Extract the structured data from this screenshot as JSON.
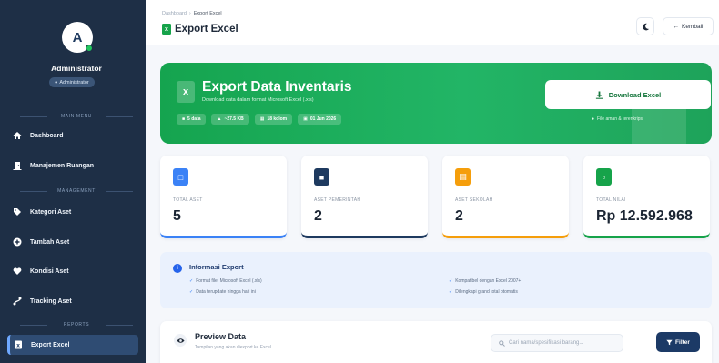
{
  "user": {
    "initial": "A",
    "name": "Administrator",
    "role": "Administrator"
  },
  "sidebar": {
    "sections": [
      "MAIN MENU",
      "MANAGEMENT",
      "REPORTS"
    ],
    "items": [
      {
        "label": "Dashboard",
        "icon": "home-icon"
      },
      {
        "label": "Manajemen Ruangan",
        "icon": "door-icon"
      },
      {
        "label": "Kategori Aset",
        "icon": "tag-icon"
      },
      {
        "label": "Tambah Aset",
        "icon": "plus-circle-icon"
      },
      {
        "label": "Kondisi Aset",
        "icon": "heart-icon"
      },
      {
        "label": "Tracking Aset",
        "icon": "route-icon"
      },
      {
        "label": "Export Excel",
        "icon": "excel-icon",
        "active": true
      }
    ]
  },
  "header": {
    "breadcrumb": [
      "Dashboard",
      "Export Excel"
    ],
    "title": "Export Excel",
    "back_label": "Kembali",
    "theme_icon": "moon-icon"
  },
  "hero": {
    "title": "Export Data Inventaris",
    "subtitle": "Download data dalam format Microsoft Excel (.xls)",
    "chips": [
      "5 data",
      "~27.5 KB",
      "18 kolom",
      "01 Jun 2026"
    ],
    "download_label": "Download Excel",
    "note": "File aman & terenkripsi",
    "accent": "#16a34a"
  },
  "stats": [
    {
      "label": "TOTAL ASET",
      "value": "5",
      "color": "#3b82f6",
      "icon": "box-icon"
    },
    {
      "label": "ASET PEMERINTAH",
      "value": "2",
      "color": "#1e3a5f",
      "icon": "building-icon"
    },
    {
      "label": "ASET SEKOLAH",
      "value": "2",
      "color": "#f59e0b",
      "icon": "school-icon"
    },
    {
      "label": "TOTAL NILAI",
      "value": "Rp 12.592.968",
      "color": "#16a34a",
      "icon": "money-icon"
    }
  ],
  "info": {
    "title": "Informasi Export",
    "left": [
      "Format file: Microsoft Excel (.xls)",
      "Data terupdate hingga hari ini"
    ],
    "right": [
      "Kompatibel dengan Excel 2007+",
      "Dilengkapi grand total otomatis"
    ]
  },
  "preview": {
    "title": "Preview Data",
    "subtitle": "Tampilan yang akan diexport ke Excel",
    "search_placeholder": "Cari nama/spesifikasi barang...",
    "filter_label": "Filter"
  }
}
